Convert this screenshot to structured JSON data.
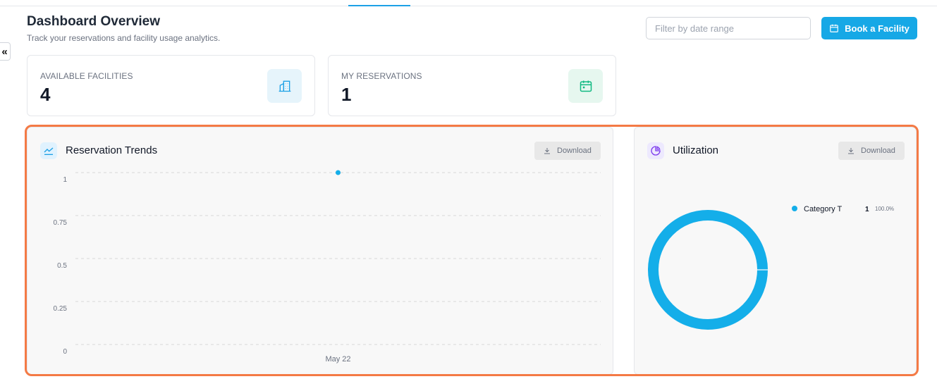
{
  "header": {
    "title": "Dashboard Overview",
    "subtitle": "Track your reservations and facility usage analytics.",
    "date_filter_placeholder": "Filter by date range",
    "book_button_label": "Book a Facility"
  },
  "sidebar": {
    "collapse_label": "«"
  },
  "stats": [
    {
      "label": "AVAILABLE FACILITIES",
      "value": "4",
      "icon": "building-icon",
      "color": "#1da1e6",
      "bg": "#e6f4fb"
    },
    {
      "label": "MY RESERVATIONS",
      "value": "1",
      "icon": "calendar-icon",
      "color": "#10b981",
      "bg": "#e6f7ef"
    }
  ],
  "trends_panel": {
    "title": "Reservation Trends",
    "download_label": "Download"
  },
  "utilization_panel": {
    "title": "Utilization",
    "download_label": "Download"
  },
  "colors": {
    "accent": "#16a8e6",
    "highlight": "#f47a45",
    "donut": "#14aee9",
    "pie_icon": "#7c3aed"
  },
  "chart_data": [
    {
      "type": "line",
      "title": "Reservation Trends",
      "x": [
        "May 22"
      ],
      "series": [
        {
          "values": [
            1
          ]
        }
      ],
      "ylim": [
        0,
        1
      ],
      "yticks": [
        "0",
        "0.25",
        "0.5",
        "0.75",
        "1"
      ],
      "grid": true
    },
    {
      "type": "pie",
      "title": "Utilization",
      "categories": [
        "Category T"
      ],
      "values": [
        1
      ],
      "percent_labels": [
        "100.0%"
      ],
      "legend": "right"
    }
  ]
}
